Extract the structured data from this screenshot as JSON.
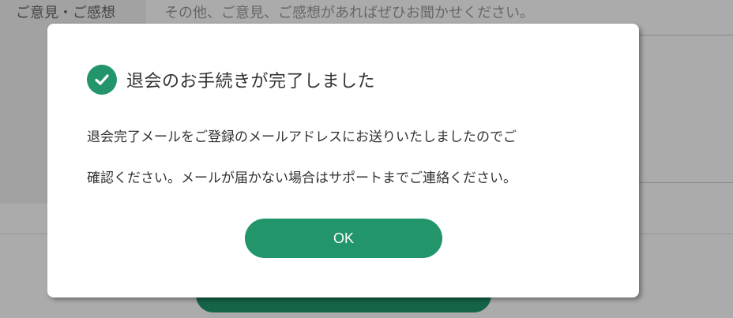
{
  "background": {
    "form_label": "ご意見・ご感想",
    "textarea_placeholder": "その他、ご意見、ご感想があればぜひお聞かせください。"
  },
  "modal": {
    "title": "退会のお手続きが完了しました",
    "message_line1": "退会完了メールをご登録のメールアドレスにお送りいたしましたのでご",
    "message_line2": "確認ください。メールが届かない場合はサポートまでご連絡ください。",
    "ok_label": "OK",
    "icon": "check-circle-icon"
  },
  "colors": {
    "accent": "#22956a",
    "overlay": "rgba(0,0,0,0.33)"
  }
}
